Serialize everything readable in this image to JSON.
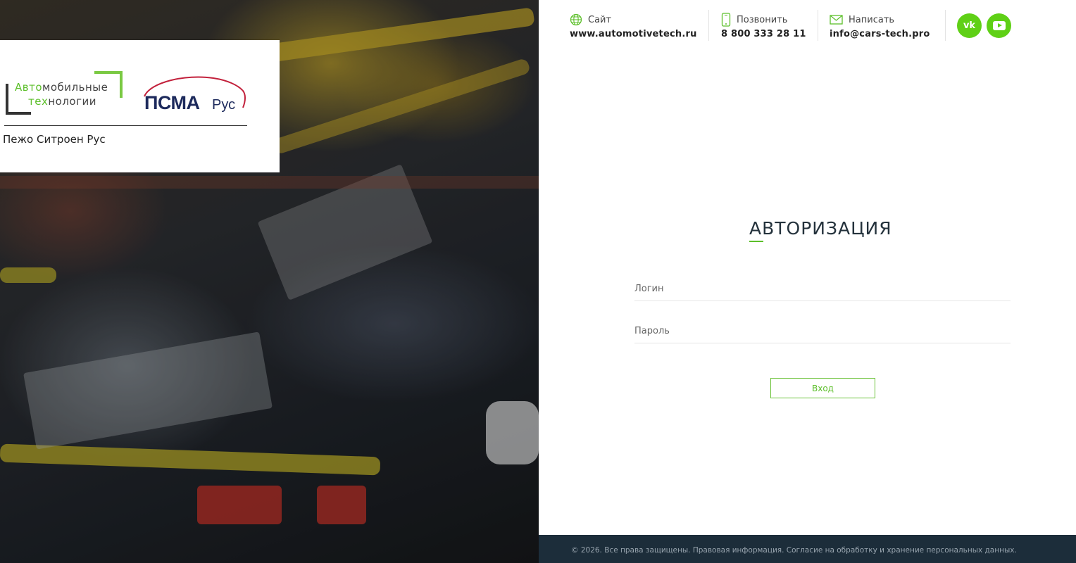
{
  "brand": {
    "at_logo": {
      "line1_green": "Авто",
      "line1_rest": "мобильные",
      "line2_green": "тех",
      "line2_rest": "нологии"
    },
    "psma_logo": {
      "main": "ПСМА",
      "suffix": "Рус"
    },
    "caption": "Пежо Ситроен Рус"
  },
  "header": {
    "site": {
      "label": "Сайт",
      "value": "www.automotivetech.ru",
      "icon": "globe-icon"
    },
    "phone": {
      "label": "Позвонить",
      "value": "8 800 333 28 11",
      "icon": "phone-icon"
    },
    "mail": {
      "label": "Написать",
      "value": "info@cars-tech.pro",
      "icon": "mail-icon"
    },
    "social": [
      {
        "name": "vk",
        "glyph": "vk"
      },
      {
        "name": "youtube",
        "glyph": "▶"
      }
    ]
  },
  "auth": {
    "title": "АВТОРИЗАЦИЯ",
    "login_placeholder": "Логин",
    "password_placeholder": "Пароль",
    "submit_label": "Вход"
  },
  "footer": {
    "text": "© 2026. Все права защищены. Правовая информация. Согласие на обработку и хранение персональных данных."
  },
  "colors": {
    "accent": "#5cbf2a",
    "social": "#5fd016",
    "footer_bg": "#1c2d3a",
    "psma_blue": "#1d2a5c",
    "psma_red": "#c2203b"
  }
}
